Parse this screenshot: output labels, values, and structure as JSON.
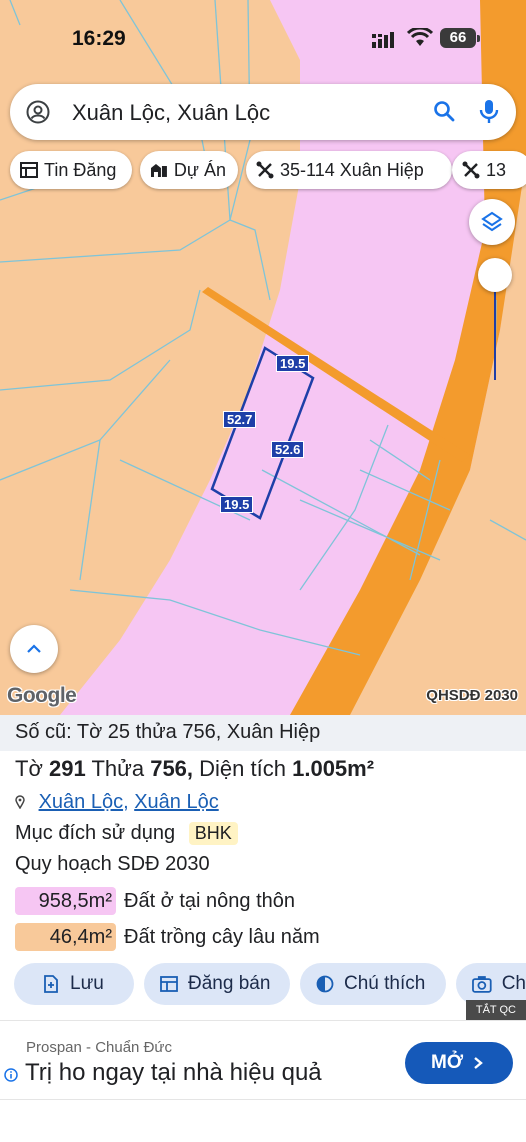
{
  "status_bar": {
    "time": "16:29",
    "battery": "66"
  },
  "search": {
    "query": "Xuân Lộc, Xuân Lộc"
  },
  "chips": [
    {
      "label": "Tin Đăng",
      "icon": "list-icon"
    },
    {
      "label": "Dự Án",
      "icon": "buildings-icon"
    },
    {
      "label": "35-114 Xuân Hiệp",
      "icon": "parcel-icon"
    },
    {
      "label": "13",
      "icon": "parcel-icon"
    }
  ],
  "map": {
    "attribution": "Google",
    "layer_label": "QHSDĐ 2030",
    "measurements": {
      "top": "19.5",
      "left": "52.7",
      "right": "52.6",
      "bottom": "19.5"
    },
    "colors": {
      "residential": "#f6c6f3",
      "perennial": "#f8c99a",
      "road": "#f39b2d",
      "parcel": "#1e3fa8"
    }
  },
  "details": {
    "old_record": "Số cũ: Tờ 25 thửa 756, Xuân Hiệp",
    "sheet_prefix": "Tờ",
    "sheet": "291",
    "parcel_prefix": "Thửa",
    "parcel": "756,",
    "area_prefix": "Diện tích",
    "area": "1.005m²",
    "location_commune": "Xuân Lộc",
    "location_separator": ",",
    "location_district": "Xuân Lộc",
    "purpose_label": "Mục đích sử dụng",
    "purpose_code": "BHK",
    "plan_label": "Quy hoạch SDĐ 2030",
    "areas": [
      {
        "value": "958,5m²",
        "label": "Đất ở tại nông thôn",
        "color": "#f6c6f3"
      },
      {
        "value": "46,4m²",
        "label": "Đất trồng cây lâu năm",
        "color": "#f8c99a"
      }
    ]
  },
  "actions": [
    {
      "label": "Lưu",
      "icon": "save-icon"
    },
    {
      "label": "Đăng bán",
      "icon": "listing-icon"
    },
    {
      "label": "Chú thích",
      "icon": "legend-icon"
    },
    {
      "label": "Ch",
      "icon": "camera-icon"
    }
  ],
  "ad": {
    "close_label": "TẮT QC",
    "brand": "Prospan - Chuẩn Đức",
    "headline": "Trị ho ngay tại nhà hiệu quả",
    "cta": "MỞ"
  }
}
